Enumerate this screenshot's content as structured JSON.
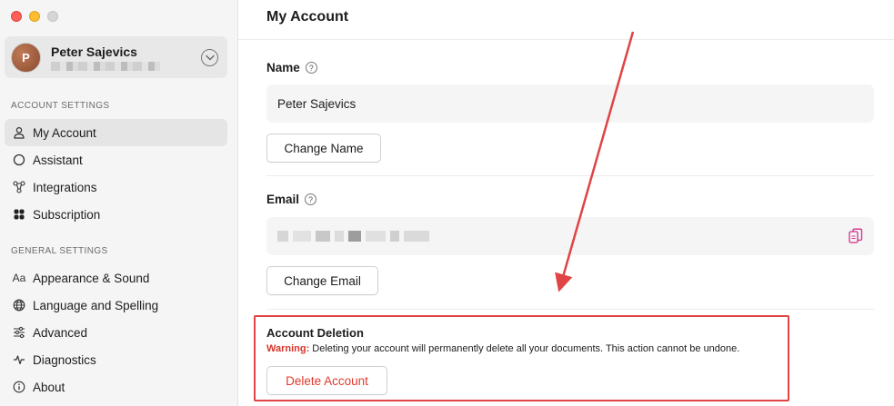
{
  "window": {
    "traffic_lights": [
      "close",
      "minimize",
      "maximize"
    ]
  },
  "sidebar": {
    "profile": {
      "avatar_initial": "P",
      "name": "Peter Sajevics",
      "email_redacted": true
    },
    "sections": [
      {
        "label": "ACCOUNT SETTINGS",
        "items": [
          {
            "label": "My Account",
            "icon": "person-icon",
            "active": true
          },
          {
            "label": "Assistant",
            "icon": "circle-icon",
            "active": false
          },
          {
            "label": "Integrations",
            "icon": "integrations-icon",
            "active": false
          },
          {
            "label": "Subscription",
            "icon": "subscription-icon",
            "active": false
          }
        ]
      },
      {
        "label": "GENERAL SETTINGS",
        "items": [
          {
            "label": "Appearance & Sound",
            "icon": "text-aa-icon",
            "active": false
          },
          {
            "label": "Language and Spelling",
            "icon": "globe-icon",
            "active": false
          },
          {
            "label": "Advanced",
            "icon": "sliders-icon",
            "active": false
          },
          {
            "label": "Diagnostics",
            "icon": "pulse-icon",
            "active": false
          },
          {
            "label": "About",
            "icon": "info-icon",
            "active": false
          }
        ]
      }
    ]
  },
  "main": {
    "title": "My Account",
    "name_field": {
      "label": "Name",
      "value": "Peter Sajevics",
      "button": "Change Name"
    },
    "email_field": {
      "label": "Email",
      "value_redacted": true,
      "button": "Change Email"
    },
    "deletion": {
      "title": "Account Deletion",
      "warning_label": "Warning:",
      "warning_text": " Deleting your account will permanently delete all your documents. This action cannot be undone.",
      "button": "Delete Account"
    }
  },
  "colors": {
    "accent_red": "#e04444",
    "warning_red": "#d8352a",
    "copy_icon_pink": "#d0308a",
    "sidebar_bg": "#f5f5f5",
    "active_item_bg": "#e5e5e5"
  }
}
